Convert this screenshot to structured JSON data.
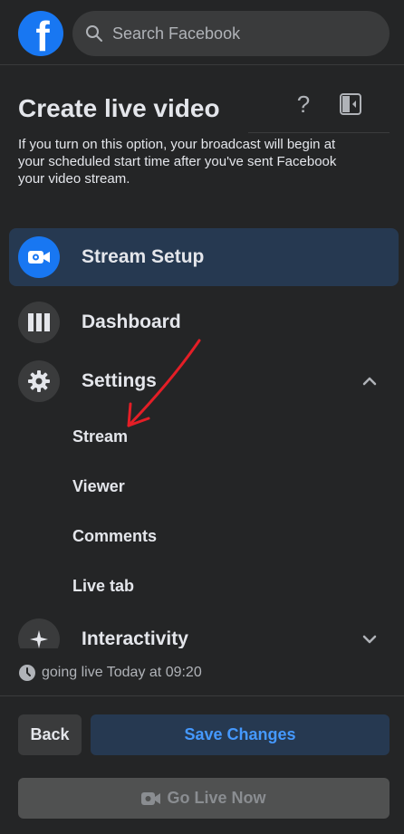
{
  "search": {
    "placeholder": "Search Facebook"
  },
  "header": {
    "title": "Create live video",
    "info": "If you turn on this option, your broadcast will begin at your scheduled start time after you've sent Facebook your video stream."
  },
  "nav": {
    "stream_setup": "Stream Setup",
    "dashboard": "Dashboard",
    "settings": "Settings",
    "settings_sub": [
      "Stream",
      "Viewer",
      "Comments",
      "Live tab"
    ],
    "interactivity": "Interactivity"
  },
  "schedule": {
    "text": "going live Today at 09:20"
  },
  "footer": {
    "back": "Back",
    "save": "Save Changes",
    "go_live": "Go Live Now"
  },
  "colors": {
    "background": "#242526",
    "accent": "#1877f2",
    "active_bg": "#263951",
    "annotation": "#e41e26"
  }
}
